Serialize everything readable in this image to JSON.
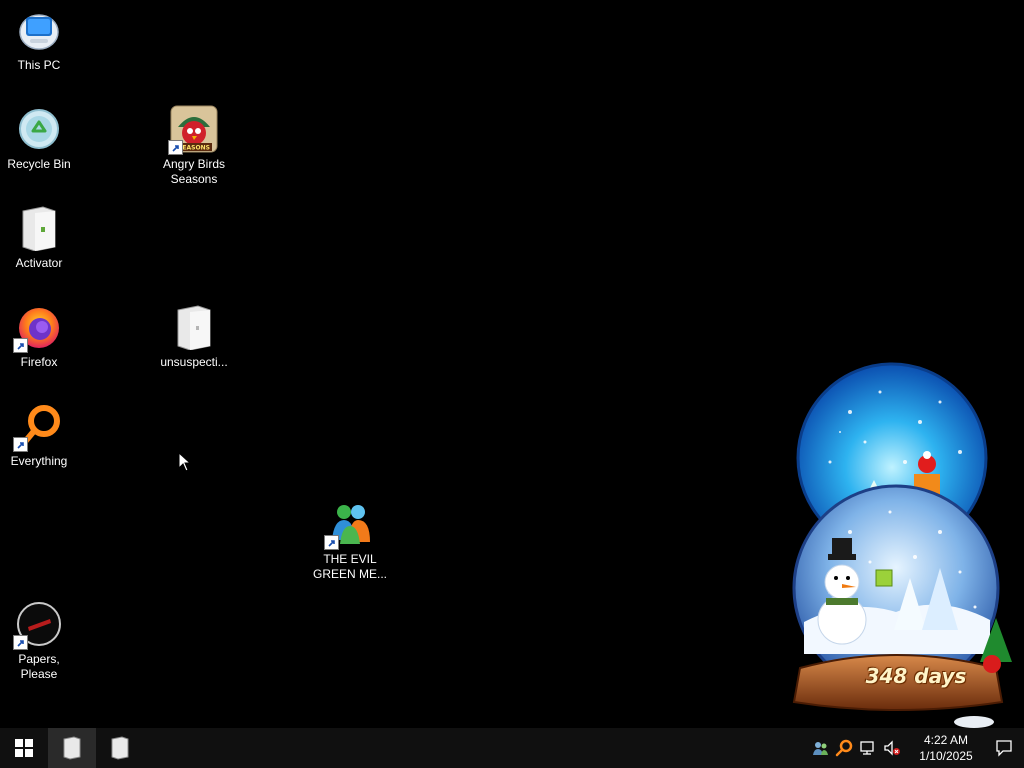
{
  "desktop": {
    "icons": [
      {
        "label": "This PC"
      },
      {
        "label": "Recycle Bin"
      },
      {
        "label": "Activator"
      },
      {
        "label": "Firefox"
      },
      {
        "label": "Everything"
      },
      {
        "label": "Papers, Please"
      },
      {
        "label": "Angry Birds Seasons"
      },
      {
        "label": "unsuspecti..."
      },
      {
        "label": "THE EVIL GREEN ME..."
      }
    ],
    "icon_logo_text": {
      "angry_birds": "SEASONS"
    }
  },
  "gadget": {
    "days_text": "348 days"
  },
  "taskbar": {
    "clock_time": "4:22 AM",
    "clock_date": "1/10/2025",
    "tray_icons": [
      "people-icon",
      "search-magnifier-icon",
      "network-icon",
      "volume-muted-icon"
    ]
  },
  "colors": {
    "desktop_bg": "#000000",
    "taskbar_bg": "#101010",
    "active_task_bg": "#2a2a2a"
  }
}
